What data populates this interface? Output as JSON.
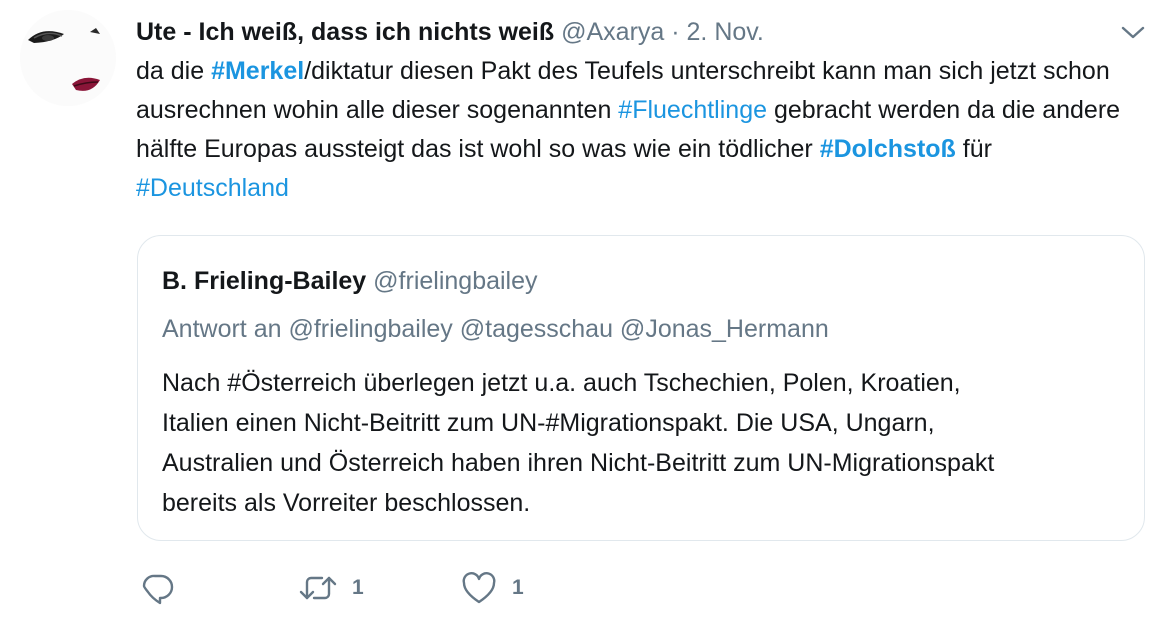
{
  "tweet": {
    "author_name": "Ute - Ich weiß, dass ich nichts weiß",
    "author_handle": "@Axarya",
    "separator": "·",
    "date": "2. Nov.",
    "text_segments": {
      "s1": "da die ",
      "h1": "#Merkel",
      "s2": "/diktatur diesen Pakt des Teufels unterschreibt kann man sich jetzt schon ausrechnen wohin alle dieser sogenannten ",
      "h2": "#Fluechtlinge",
      "s3": " gebracht werden da die andere hälfte Europas aussteigt das ist wohl so was wie ein tödlicher ",
      "h3": "#Dolchstoß",
      "s4": " für ",
      "h4": "#Deutschland"
    }
  },
  "quoted_tweet": {
    "author_name": "B. Frieling-Bailey",
    "author_handle": "@frielingbailey",
    "reply_to": "Antwort an @frielingbailey @tagesschau @Jonas_Hermann",
    "text_lines": [
      "Nach #Österreich überlegen jetzt u.a. auch Tschechien, Polen, Kroatien,",
      "Italien einen Nicht-Beitritt zum UN-#Migrationspakt. Die USA, Ungarn,",
      "Australien und Österreich haben ihren Nicht-Beitritt zum UN-Migrationspakt",
      "bereits als Vorreiter beschlossen."
    ]
  },
  "actions": {
    "reply_icon": "reply-icon",
    "retweet_icon": "retweet-icon",
    "retweet_count": "1",
    "like_icon": "heart-icon",
    "like_count": "1"
  },
  "colors": {
    "text": "#14171a",
    "secondary": "#657786",
    "link": "#1b95e0",
    "border": "#e1e8ed"
  }
}
